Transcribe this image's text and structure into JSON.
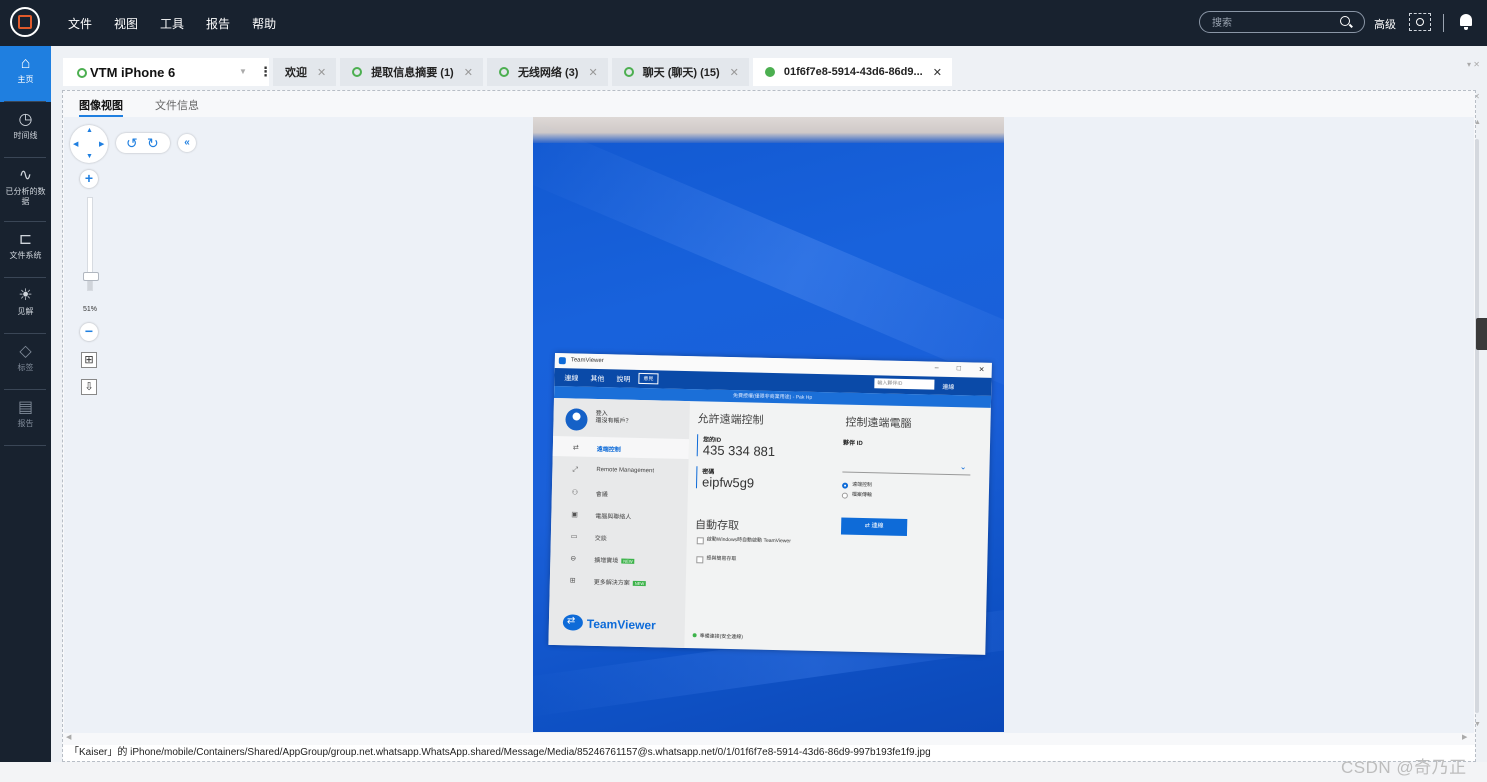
{
  "topbar": {
    "menu": [
      "文件",
      "视图",
      "工具",
      "报告",
      "帮助"
    ],
    "search_placeholder": "搜索",
    "advanced_label": "高级"
  },
  "sidebar": {
    "items": [
      {
        "label": "主页",
        "icon": "home-icon"
      },
      {
        "label": "时间线",
        "icon": "clock-icon"
      },
      {
        "label": "已分析的数据",
        "icon": "pulse-icon"
      },
      {
        "label": "文件系统",
        "icon": "tree-icon"
      },
      {
        "label": "见解",
        "icon": "bulb-icon"
      },
      {
        "label": "标签",
        "icon": "tag-icon"
      },
      {
        "label": "报告",
        "icon": "report-icon"
      }
    ]
  },
  "device_tab": {
    "name": "VTM iPhone 6"
  },
  "tabs": [
    {
      "label": "欢迎"
    },
    {
      "label": "提取信息摘要 (1)"
    },
    {
      "label": "无线网络 (3)"
    },
    {
      "label": "聊天 (聊天) (15)"
    },
    {
      "label": "01f6f7e8-5914-43d6-86d9..."
    }
  ],
  "subtabs": [
    "图像视图",
    "文件信息"
  ],
  "viewer": {
    "zoom_percent": "51%",
    "zoom_level": 0.51
  },
  "photo": {
    "tv_title": "TeamViewer",
    "tv_menu": [
      "連線",
      "其他",
      "說明"
    ],
    "tv_feedback": "意見",
    "tv_id_placeholder": "輸入夥伴ID",
    "tv_connect_small": "連線",
    "tv_banner": "免費授權(僅限非商業用途) - Pak Hp",
    "tv_login_1": "登入",
    "tv_login_2": "還沒有帳戶？",
    "tv_nav": [
      "遠端控制",
      "Remote Management",
      "會議",
      "電腦與聯絡人",
      "交談",
      "擴增實境",
      "更多解決方案"
    ],
    "tv_new_badge": "NEW",
    "tv_allow_heading": "允許遠端控制",
    "tv_control_heading": "控制遠端電腦",
    "tv_your_id_label": "您的ID",
    "tv_your_id": "435 334 881",
    "tv_pwd_label": "密碼",
    "tv_pwd": "eipfw5g9",
    "tv_partner_label": "夥伴 ID",
    "tv_radio_1": "遠端控制",
    "tv_radio_2": "檔案傳輸",
    "tv_connect_btn": "連線",
    "tv_unattended_heading": "自動存取",
    "tv_check_1": "啟動Windows時自動啟動 TeamViewer",
    "tv_check_2": "授與簡易存取",
    "tv_status": "準備連接(安全連線)",
    "tv_brand": "TeamViewer"
  },
  "path": "「Kaiser」的 iPhone/mobile/Containers/Shared/AppGroup/group.net.whatsapp.WhatsApp.shared/Message/Media/85246761157@s.whatsapp.net/0/1/01f6f7e8-5914-43d6-86d9-997b193fe1f9.jpg",
  "watermark": "CSDN @奇乃正",
  "colors": {
    "accent": "#1f7fe0",
    "topbar": "#18222f",
    "status_green": "#4caf50"
  }
}
